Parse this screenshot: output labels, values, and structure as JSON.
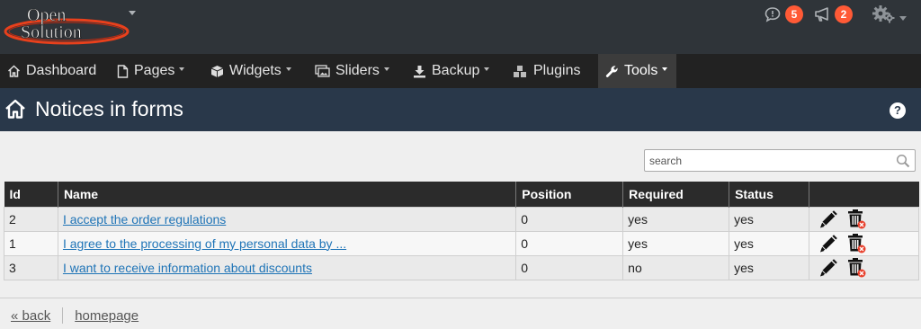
{
  "brand": {
    "line1": "Open",
    "line2": "Solution"
  },
  "topbar": {
    "messages_count": "5",
    "announcements_count": "2"
  },
  "nav": {
    "dashboard": "Dashboard",
    "pages": "Pages",
    "widgets": "Widgets",
    "sliders": "Sliders",
    "backup": "Backup",
    "plugins": "Plugins",
    "tools": "Tools"
  },
  "page": {
    "title": "Notices in forms",
    "help": "?"
  },
  "search": {
    "placeholder": "search",
    "value": ""
  },
  "table": {
    "headers": {
      "id": "Id",
      "name": "Name",
      "position": "Position",
      "required": "Required",
      "status": "Status",
      "actions": ""
    },
    "rows": [
      {
        "id": "2",
        "name": "I accept the order regulations",
        "position": "0",
        "required": "yes",
        "status": "yes"
      },
      {
        "id": "1",
        "name": "I agree to the processing of my personal data by ...",
        "position": "0",
        "required": "yes",
        "status": "yes"
      },
      {
        "id": "3",
        "name": "I want to receive information about discounts",
        "position": "0",
        "required": "no",
        "status": "yes"
      }
    ]
  },
  "footer": {
    "back": "« back",
    "homepage": "homepage"
  },
  "colors": {
    "topbar": "#2f3439",
    "navbar": "#222222",
    "header": "#29384a",
    "badge": "#ff5a36",
    "link": "#1f74b7"
  }
}
